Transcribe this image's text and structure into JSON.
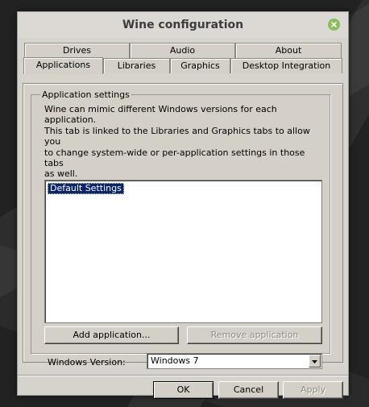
{
  "window": {
    "title": "Wine configuration"
  },
  "tabs": {
    "top_row": [
      "Drives",
      "Audio",
      "About"
    ],
    "bottom_row": [
      "Applications",
      "Libraries",
      "Graphics",
      "Desktop Integration"
    ],
    "active": "Applications"
  },
  "applications": {
    "group_label": "Application settings",
    "description": "Wine can mimic different Windows versions for each application.\nThis tab is linked to the Libraries and Graphics tabs to allow you\nto change system-wide or per-application settings in those tabs\nas well.",
    "list_items": [
      "Default Settings"
    ],
    "add_button": "Add application...",
    "remove_button": "Remove application",
    "windows_version_label": "Windows Version:",
    "windows_version_value": "Windows 7"
  },
  "buttons": {
    "ok": "OK",
    "cancel": "Cancel",
    "apply": "Apply"
  },
  "colors": {
    "selection": "#0a246a",
    "close_button": "#87bf5a",
    "dialog_face": "#d4d0c8"
  },
  "icons": {
    "close": "close-icon",
    "dropdown": "chevron-down-icon"
  }
}
